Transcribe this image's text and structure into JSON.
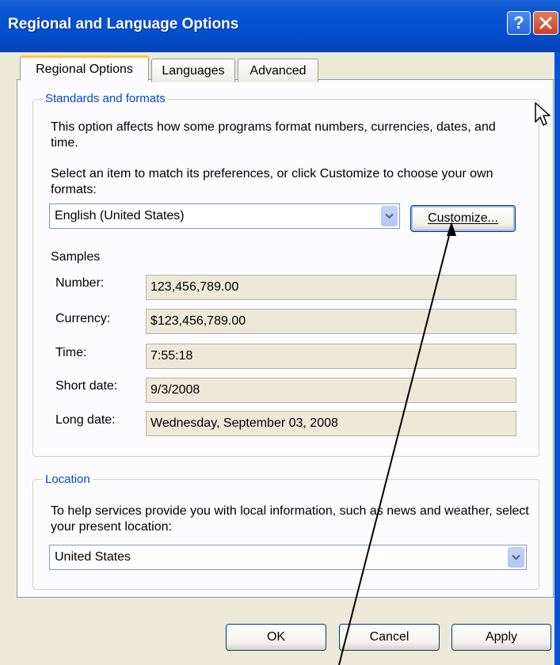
{
  "window": {
    "title": "Regional and Language Options",
    "help_symbol": "?",
    "close_symbol": "✕"
  },
  "tabs": [
    {
      "label": "Regional Options",
      "selected": true
    },
    {
      "label": "Languages",
      "selected": false
    },
    {
      "label": "Advanced",
      "selected": false
    }
  ],
  "standards": {
    "legend": "Standards and formats",
    "description": "This option affects how some programs format numbers, currencies, dates, and time.",
    "select_prompt": "Select an item to match its preferences, or click Customize to choose your own formats:",
    "locale_value": "English (United States)",
    "customize_label": "Customize...",
    "samples_heading": "Samples",
    "samples": [
      {
        "label": "Number:",
        "value": "123,456,789.00"
      },
      {
        "label": "Currency:",
        "value": "$123,456,789.00"
      },
      {
        "label": "Time:",
        "value": "7:55:18"
      },
      {
        "label": "Short date:",
        "value": "9/3/2008"
      },
      {
        "label": "Long date:",
        "value": "Wednesday, September 03, 2008"
      }
    ]
  },
  "location": {
    "legend": "Location",
    "description": "To help services provide you with local information, such as news and weather, select your present location:",
    "value": "United States"
  },
  "footer": {
    "ok_label": "OK",
    "cancel_label": "Cancel",
    "apply_label": "Apply"
  },
  "colors": {
    "titlebar": "#0a56d2",
    "dialog_bg": "#ece9d8",
    "group_legend": "#0046d5",
    "tab_highlight": "#ffc83c"
  },
  "icons": {
    "help": "help-icon",
    "close": "close-icon",
    "dropdown": "chevron-down-icon",
    "cursor": "mouse-cursor-icon",
    "annotation": "annotation-arrow"
  }
}
